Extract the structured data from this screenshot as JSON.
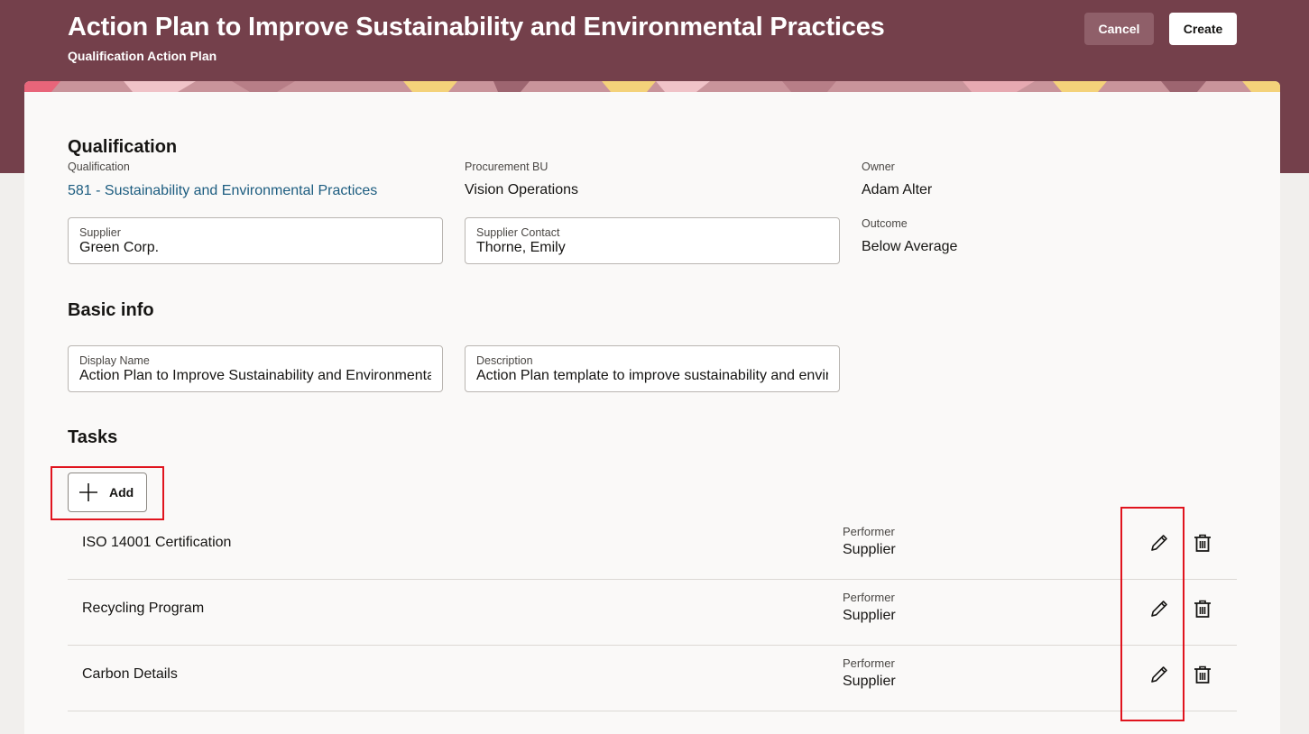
{
  "header": {
    "title": "Action Plan to Improve Sustainability and Environmental Practices",
    "subtitle": "Qualification Action Plan",
    "cancel_label": "Cancel",
    "create_label": "Create"
  },
  "colors": {
    "header_bg": "#74404b",
    "link": "#1d5d80",
    "highlight": "#e0141e"
  },
  "qualification": {
    "heading": "Qualification",
    "qualification_label": "Qualification",
    "qualification_value": "581 - Sustainability and Environmental Practices",
    "procurement_bu_label": "Procurement BU",
    "procurement_bu_value": "Vision Operations",
    "owner_label": "Owner",
    "owner_value": "Adam Alter",
    "supplier_label": "Supplier",
    "supplier_value": "Green Corp.",
    "supplier_contact_label": "Supplier Contact",
    "supplier_contact_value": "Thorne, Emily",
    "outcome_label": "Outcome",
    "outcome_value": "Below Average"
  },
  "basic_info": {
    "heading": "Basic info",
    "display_name_label": "Display Name",
    "display_name_value": "Action Plan to Improve Sustainability and Environmental Practices",
    "description_label": "Description",
    "description_value": "Action Plan template to improve sustainability and environmental practices"
  },
  "tasks": {
    "heading": "Tasks",
    "add_label": "Add",
    "items": [
      {
        "name": "ISO 14001 Certification",
        "performer_label": "Performer",
        "performer_value": "Supplier",
        "edit_icon": "pencil-icon",
        "delete_icon": "trash-icon"
      },
      {
        "name": "Recycling Program",
        "performer_label": "Performer",
        "performer_value": "Supplier",
        "edit_icon": "pencil-icon",
        "delete_icon": "trash-icon"
      },
      {
        "name": "Carbon Details",
        "performer_label": "Performer",
        "performer_value": "Supplier",
        "edit_icon": "pencil-icon",
        "delete_icon": "trash-icon"
      }
    ]
  }
}
